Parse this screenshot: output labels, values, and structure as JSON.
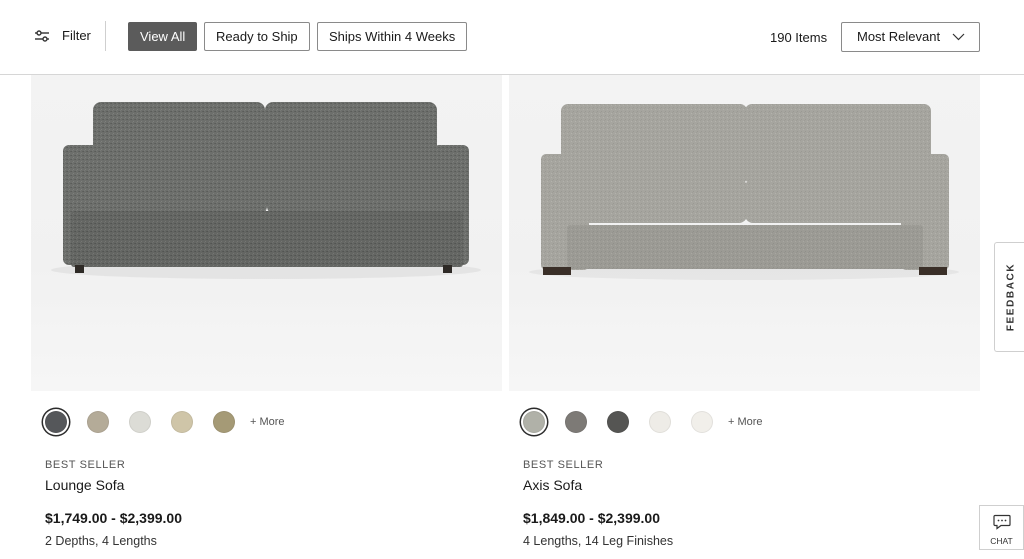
{
  "toolbar": {
    "filter_label": "Filter",
    "pills": [
      {
        "label": "View All",
        "active": true
      },
      {
        "label": "Ready to Ship",
        "active": false
      },
      {
        "label": "Ships Within 4 Weeks",
        "active": false
      }
    ],
    "count_label": "190 Items",
    "sort_label": "Most Relevant"
  },
  "products": [
    {
      "badge": "BEST SELLER",
      "name": "Lounge Sofa",
      "price": "$1,749.00 - $2,399.00",
      "options": "2 Depths, 4 Lengths",
      "more_label": "+ More",
      "swatch_colors": [
        "#55575a",
        "#b4ab98",
        "#dcdcd6",
        "#cfc5a8",
        "#a59a76"
      ],
      "selected_swatch": 0
    },
    {
      "badge": "BEST SELLER",
      "name": "Axis Sofa",
      "price": "$1,849.00 - $2,399.00",
      "options": "4 Lengths, 14 Leg Finishes",
      "more_label": "+ More",
      "swatch_colors": [
        "#b0b1a8",
        "#7d7a76",
        "#555553",
        "#eeece7",
        "#f1efea"
      ],
      "selected_swatch": 0
    }
  ],
  "feedback_label": "FEEDBACK",
  "chat_label": "CHAT",
  "icons": {
    "filter": "sliders-icon",
    "sort": "chevron-down-icon",
    "chat": "chat-bubble-icon"
  }
}
